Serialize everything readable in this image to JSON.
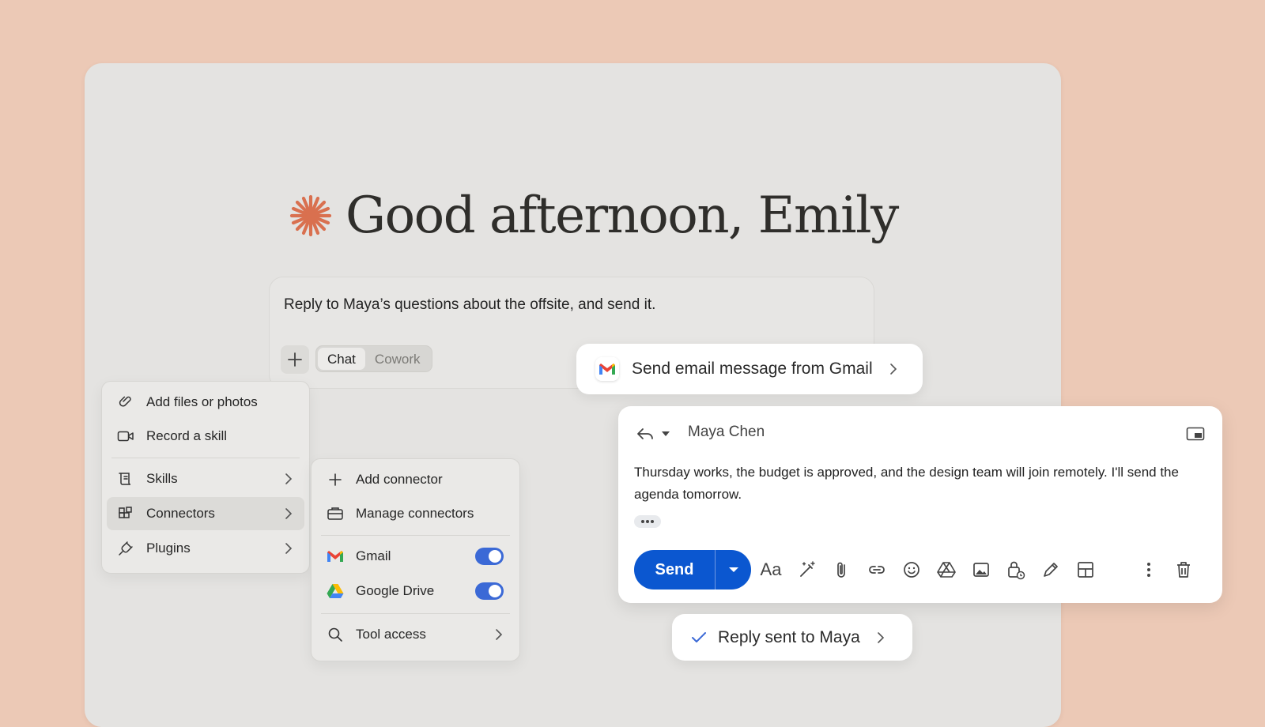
{
  "greeting": {
    "text": "Good afternoon, Emily",
    "star_color": "#d9704f"
  },
  "prompt": {
    "text": "Reply to Maya’s questions about the offsite, and send it.",
    "modes": [
      "Chat",
      "Cowork"
    ],
    "active_mode": "Chat"
  },
  "menu": {
    "items": [
      {
        "label": "Add files or photos",
        "icon": "paperclip-icon"
      },
      {
        "label": "Record a skill",
        "icon": "video-camera-icon"
      },
      {
        "label": "Skills",
        "icon": "scroll-icon"
      },
      {
        "label": "Connectors",
        "icon": "connector-grid-icon",
        "highlighted": true
      },
      {
        "label": "Plugins",
        "icon": "plug-icon"
      }
    ]
  },
  "connectors_menu": {
    "add": "Add connector",
    "manage": "Manage connectors",
    "gmail": {
      "label": "Gmail",
      "enabled": true
    },
    "drive": {
      "label": "Google Drive",
      "enabled": true
    },
    "tool_access": "Tool access",
    "toggle_color": "#3b69d6"
  },
  "action_pill": {
    "label": "Send email message from Gmail"
  },
  "email": {
    "recipient": "Maya Chen",
    "body": "Thursday works, the budget is approved, and the design team will join remotely. I'll send the agenda tomorrow.",
    "send_label": "Send",
    "format_label": "Aa",
    "send_color": "#0b57d0"
  },
  "status_pill": {
    "label": "Reply sent to Maya"
  }
}
